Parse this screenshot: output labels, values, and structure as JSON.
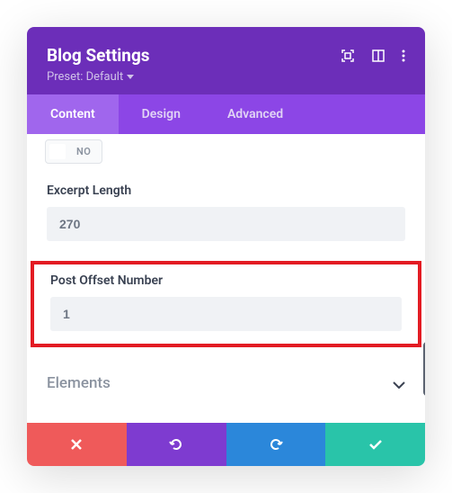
{
  "header": {
    "title": "Blog Settings",
    "preset_label": "Preset: Default"
  },
  "tabs": {
    "content": "Content",
    "design": "Design",
    "advanced": "Advanced"
  },
  "content": {
    "toggle_no": "NO",
    "excerpt_label": "Excerpt Length",
    "excerpt_value": "270",
    "offset_label": "Post Offset Number",
    "offset_value": "1",
    "elements_section": "Elements"
  }
}
